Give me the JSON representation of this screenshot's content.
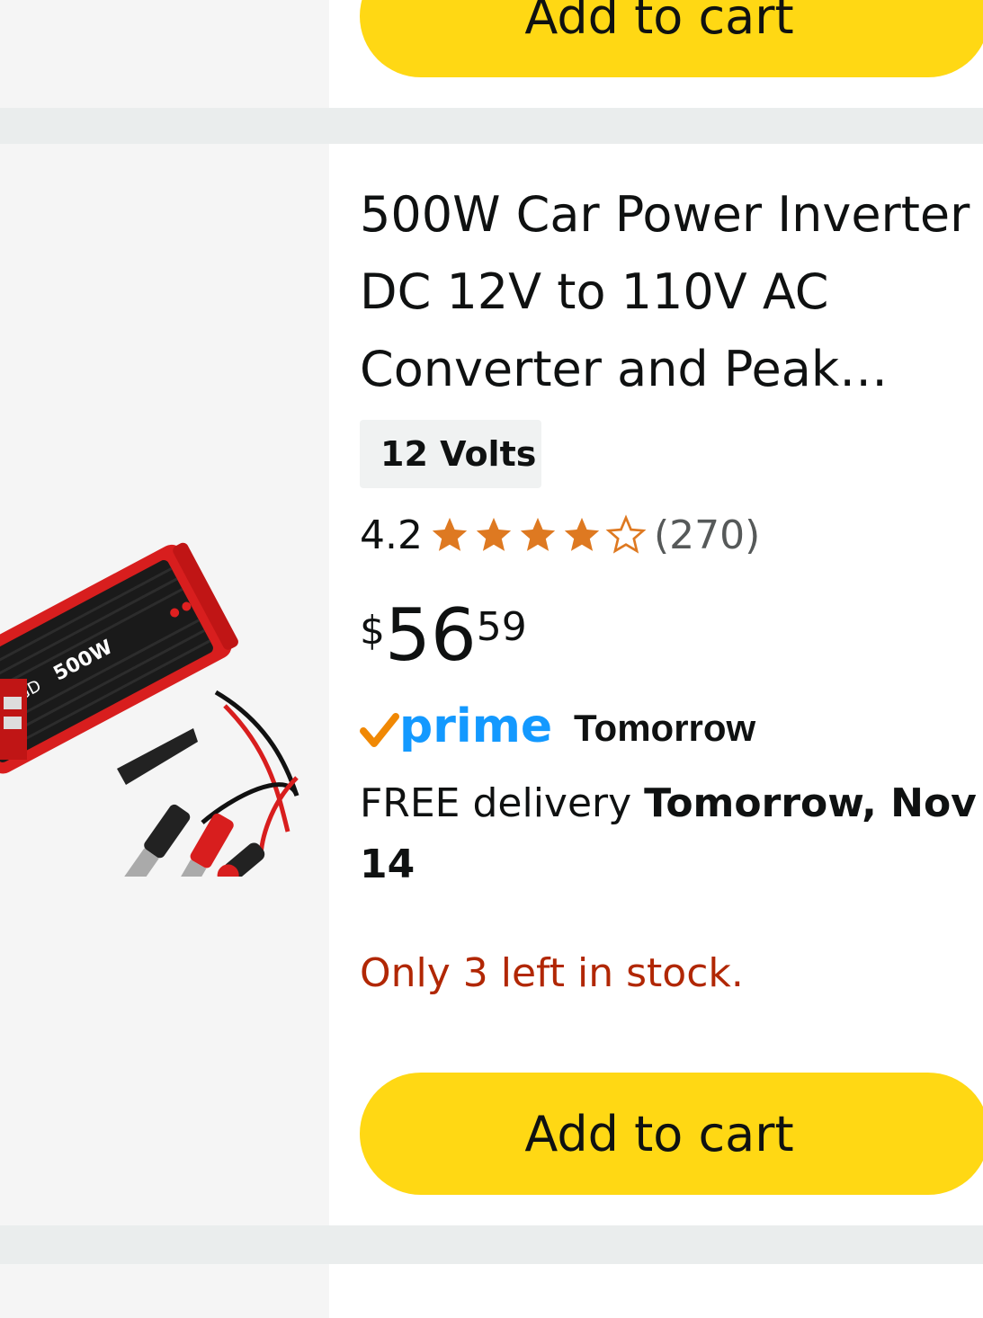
{
  "top_card": {
    "add_to_cart_label": "Add to cart"
  },
  "product": {
    "title": "500W Car Power Inverter DC 12V to 110V AC Converter and Peak…",
    "variant": "12 Volts",
    "rating": "4.2",
    "rating_value": 4.2,
    "rating_max": 5,
    "review_count": "(270)",
    "price_symbol": "$",
    "price_whole": "56",
    "price_fraction": "59",
    "prime_label": "prime",
    "prime_delivery": "Tomorrow",
    "delivery_prefix": "FREE delivery",
    "delivery_date": "Tomorrow, Nov 14",
    "stock_text": "Only 3 left in stock.",
    "add_to_cart_label": "Add to cart",
    "image_brand": "BYGD",
    "image_model": "500W"
  },
  "colors": {
    "button_yellow": "#ffd814",
    "star_orange": "#de7921",
    "stock_red": "#b12704",
    "prime_blue": "#1399ff",
    "prime_check": "#f08804"
  }
}
